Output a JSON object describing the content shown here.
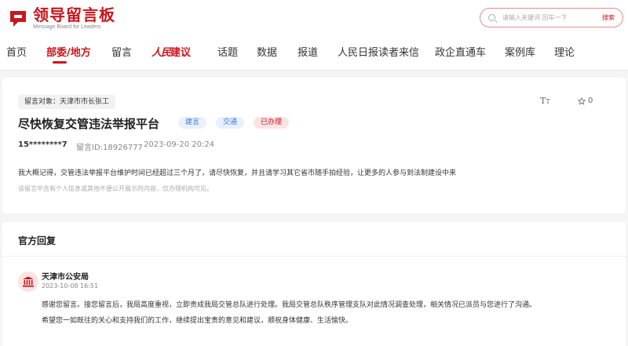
{
  "site": {
    "logo_cn": "领导留言板",
    "logo_en": "Message Board for Leaders",
    "brand_color": "#c8161d"
  },
  "search": {
    "placeholder": "请输入关键词 回车一下",
    "button_label": "搜索"
  },
  "nav": {
    "items": [
      {
        "label": "首页"
      },
      {
        "label": "部委/地方"
      },
      {
        "label": "留言"
      },
      {
        "label_calligraphy": "人民",
        "label_suffix": "建议"
      },
      {
        "label": "话题"
      },
      {
        "label": "数据"
      },
      {
        "label": "报道"
      },
      {
        "label": "人民日报读者来信"
      },
      {
        "label": "政企直通车"
      },
      {
        "label": "案例库"
      },
      {
        "label": "理论"
      }
    ],
    "active": "部委/地方"
  },
  "message": {
    "target": "留言对象：天津市市长张工",
    "title": "尽快恢复交管违法举报平台",
    "tags": [
      "建言",
      "交通",
      "已办理"
    ],
    "font_icon": "font-size-icon",
    "favorite_count": "0",
    "user": "15********7",
    "id_text": "留言ID:18926777",
    "time": "2023-09-20 20:24",
    "content": "我大概记得，交管违法举报平台维护时间已经超过三个月了，请尽快恢复，并且请学习其它省市随手拍经验，让更多的人参与到法制建设中来",
    "privacy_note": "该留言中含有个人信息或其他不便公开展示的内容，仅办理机构可见。"
  },
  "reply": {
    "section_title": "官方回复",
    "org_name": "天津市公安局",
    "org_icon": "government-building-icon",
    "time": "2023-10-08 16:51",
    "paragraph1": "感谢您留言。接您留言后，我局高度重视，立即责成我局交管总队进行处理。我局交管总队秩序管理支队对此情况调查处理，相关情况已派员与您进行了沟通。",
    "paragraph2": "希望您一如既往的关心和支持我们的工作，继续提出宝贵的意见和建议，顺祝身体健康、生活愉快。"
  }
}
